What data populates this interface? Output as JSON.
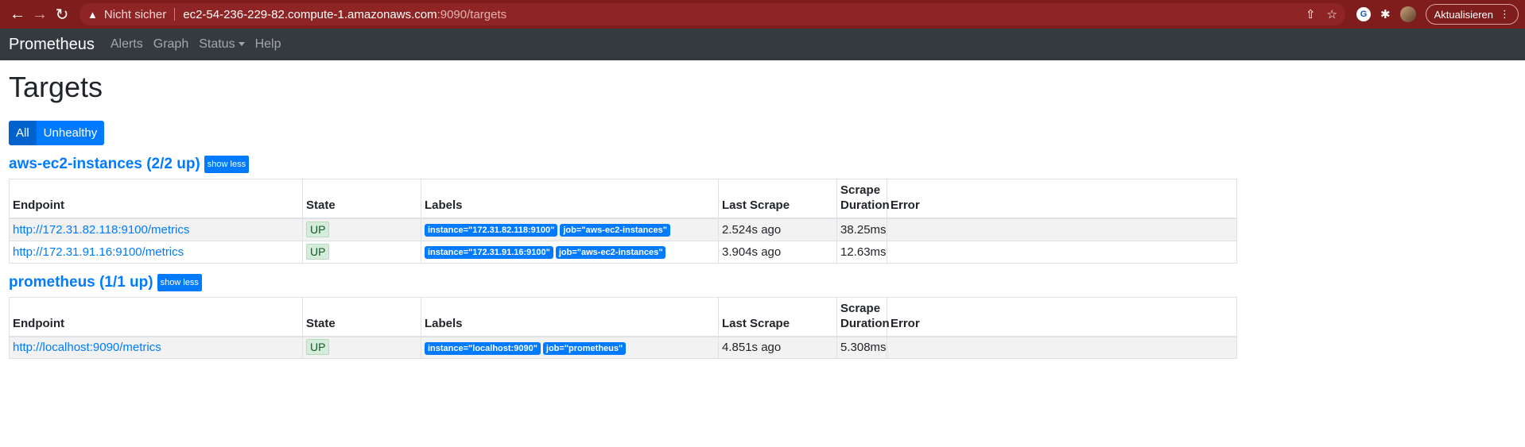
{
  "browser": {
    "insecure_text": "Nicht sicher",
    "url_host": "ec2-54-236-229-82.compute-1.amazonaws.com",
    "url_path": ":9090/targets",
    "update_label": "Aktualisieren"
  },
  "navbar": {
    "brand": "Prometheus",
    "links": [
      "Alerts",
      "Graph",
      "Status",
      "Help"
    ]
  },
  "page": {
    "title": "Targets",
    "filters": [
      "All",
      "Unhealthy"
    ]
  },
  "columns": [
    "Endpoint",
    "State",
    "Labels",
    "Last Scrape",
    "Scrape",
    "Duration",
    "Error"
  ],
  "pools": [
    {
      "title": "aws-ec2-instances (2/2 up)",
      "toggle_label": "show less",
      "rows": [
        {
          "endpoint": "http://172.31.82.118:9100/metrics",
          "state": "UP",
          "labels": [
            "instance=\"172.31.82.118:9100\"",
            "job=\"aws-ec2-instances\""
          ],
          "last_scrape": "2.524s ago",
          "duration": "38.25ms",
          "error": ""
        },
        {
          "endpoint": "http://172.31.91.16:9100/metrics",
          "state": "UP",
          "labels": [
            "instance=\"172.31.91.16:9100\"",
            "job=\"aws-ec2-instances\""
          ],
          "last_scrape": "3.904s ago",
          "duration": "12.63ms",
          "error": ""
        }
      ]
    },
    {
      "title": "prometheus (1/1 up)",
      "toggle_label": "show less",
      "rows": [
        {
          "endpoint": "http://localhost:9090/metrics",
          "state": "UP",
          "labels": [
            "instance=\"localhost:9090\"",
            "job=\"prometheus\""
          ],
          "last_scrape": "4.851s ago",
          "duration": "5.308ms",
          "error": ""
        }
      ]
    }
  ],
  "colors": {
    "primary": "#007bff",
    "navbar": "#343a40",
    "up_badge_bg": "#d4edda",
    "up_badge_text": "#155724"
  }
}
